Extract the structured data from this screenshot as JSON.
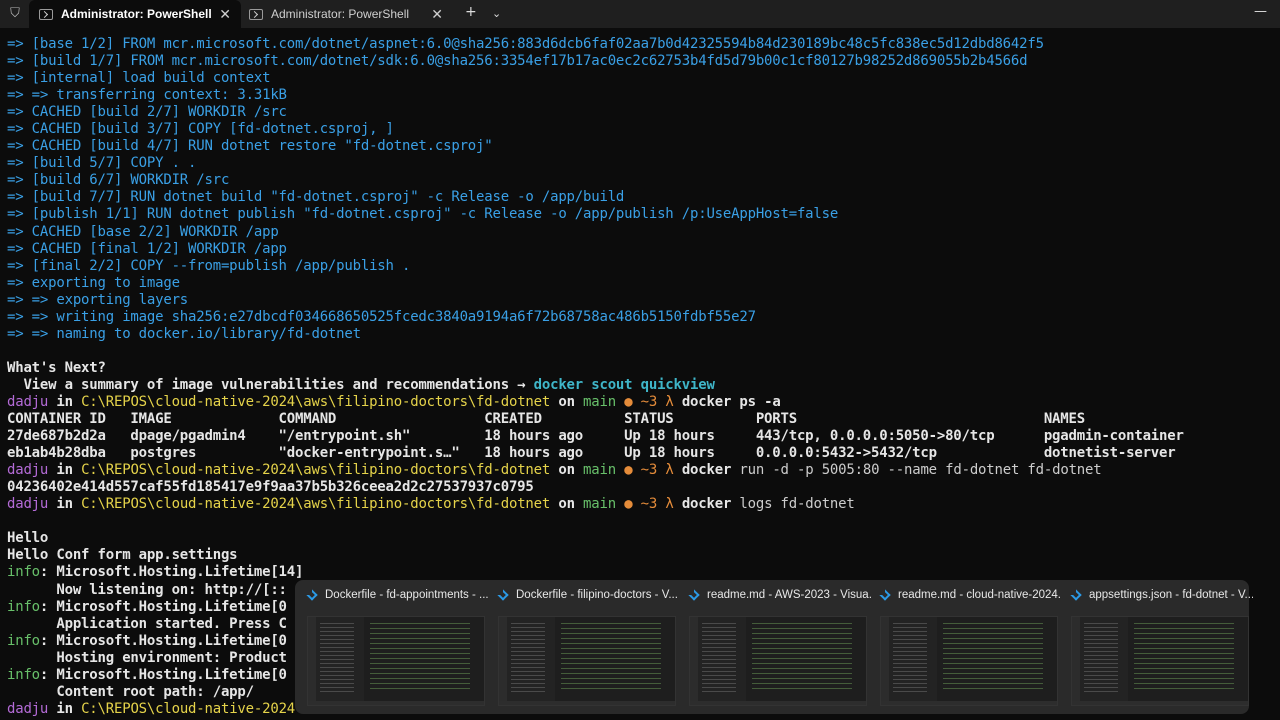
{
  "tabs": [
    {
      "label": "Administrator: PowerShell"
    },
    {
      "label": "Administrator: PowerShell"
    }
  ],
  "terminal": {
    "build_lines": [
      "=> [base 1/2] FROM mcr.microsoft.com/dotnet/aspnet:6.0@sha256:883d6dcb6faf02aa7b0d42325594b84d230189bc48c5fc838ec5d12dbd8642f5",
      "=> [build 1/7] FROM mcr.microsoft.com/dotnet/sdk:6.0@sha256:3354ef17b17ac0ec2c62753b4fd5d79b00c1cf80127b98252d869055b2b4566d",
      "=> [internal] load build context",
      "=> => transferring context: 3.31kB",
      "=> CACHED [build 2/7] WORKDIR /src",
      "=> CACHED [build 3/7] COPY [fd-dotnet.csproj, ]",
      "=> CACHED [build 4/7] RUN dotnet restore \"fd-dotnet.csproj\"",
      "=> [build 5/7] COPY . .",
      "=> [build 6/7] WORKDIR /src",
      "=> [build 7/7] RUN dotnet build \"fd-dotnet.csproj\" -c Release -o /app/build",
      "=> [publish 1/1] RUN dotnet publish \"fd-dotnet.csproj\" -c Release -o /app/publish /p:UseAppHost=false",
      "=> CACHED [base 2/2] WORKDIR /app",
      "=> CACHED [final 1/2] WORKDIR /app",
      "=> [final 2/2] COPY --from=publish /app/publish .",
      "=> exporting to image",
      "=> => exporting layers",
      "=> => writing image sha256:e27dbcdf034668650525fcedc3840a9194a6f72b68758ac486b5150fdbf55e27",
      "=> => naming to docker.io/library/fd-dotnet"
    ],
    "whats_next": "What's Next?",
    "summary_text": "  View a summary of image vulnerabilities and recommendations → ",
    "summary_cmd": "docker scout quickview",
    "prompt": {
      "user": "dadju",
      "in": " in ",
      "path": "C:\\REPOS\\cloud-native-2024\\aws\\filipino-doctors\\fd-dotnet",
      "on": " on ",
      "branch": "main",
      "dot": " ● ",
      "ahead": "~3",
      "lambda": " λ "
    },
    "cmd1": "docker ps -a",
    "ps_header": "CONTAINER ID   IMAGE             COMMAND                  CREATED          STATUS          PORTS                              NAMES",
    "ps_rows": [
      "27de687b2d2a   dpage/pgadmin4    \"/entrypoint.sh\"         18 hours ago     Up 18 hours     443/tcp, 0.0.0.0:5050->80/tcp      pgadmin-container",
      "eb1ab4b28dba   postgres          \"docker-entrypoint.s…\"   18 hours ago     Up 18 hours     0.0.0.0:5432->5432/tcp             dotnetist-server"
    ],
    "cmd2_name": "docker",
    "cmd2_rest": " run -d -p 5005:80 --name fd-dotnet fd-dotnet",
    "container_id": "04236402e414d557caf55fd185417e9f9aa37b5b326ceea2d2c27537937c0795",
    "cmd3_name": "docker",
    "cmd3_rest": " logs fd-dotnet",
    "hello1": "Hello",
    "hello2": "Hello Conf form app.settings",
    "log": {
      "info_label": "info",
      "line1": ": Microsoft.Hosting.Lifetime[14]",
      "line2": "      Now listening on: http://[::",
      "line3": ": Microsoft.Hosting.Lifetime[0",
      "line4": "      Application started. Press C",
      "line5": ": Microsoft.Hosting.Lifetime[0",
      "line6": "      Hosting environment: Product",
      "line7": ": Microsoft.Hosting.Lifetime[0",
      "line8": "      Content root path: /app/"
    },
    "last_prompt_path": "C:\\REPOS\\cloud-native-2024"
  },
  "previews": [
    {
      "title": "Dockerfile - fd-appointments - ..."
    },
    {
      "title": "Dockerfile - filipino-doctors - V..."
    },
    {
      "title": "readme.md - AWS-2023 - Visua..."
    },
    {
      "title": "readme.md - cloud-native-2024..."
    },
    {
      "title": "appsettings.json - fd-dotnet - V..."
    }
  ],
  "colors": {
    "accent_blue": "#3aa0e6",
    "prompt_purple": "#b46bd7",
    "path_yellow": "#e5d34a",
    "branch_green": "#68c06a",
    "dot_orange": "#e58c3a",
    "vscode_blue": "#2b9ae6"
  },
  "icons": [
    "shield-icon",
    "powershell-tab-icon",
    "close-icon",
    "new-tab-plus-icon",
    "dropdown-chevron-icon",
    "minimize-icon",
    "vscode-icon"
  ]
}
